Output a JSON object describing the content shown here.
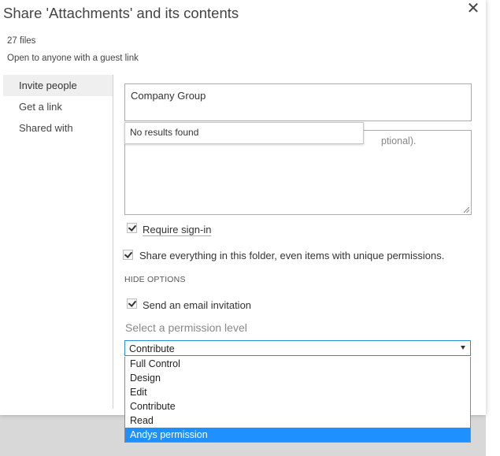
{
  "dialog": {
    "title": "Share 'Attachments' and its contents",
    "close_glyph": "✕",
    "file_count": "27 files",
    "sharing_status": "Open to anyone with a guest link"
  },
  "nav": {
    "items": [
      {
        "label": "Invite people",
        "active": true
      },
      {
        "label": "Get a link",
        "active": false
      },
      {
        "label": "Shared with",
        "active": false
      }
    ]
  },
  "invite": {
    "people_value": "Company Group",
    "people_suggestion": "No results found",
    "message_placeholder_visible_tail": "ptional)."
  },
  "options": {
    "require_signin": {
      "label": "Require sign-in",
      "checked": true
    },
    "share_everything": {
      "label": "Share everything in this folder, even items with unique permissions.",
      "checked": true
    },
    "hide_options_label": "HIDE OPTIONS",
    "send_email": {
      "label": "Send an email invitation",
      "checked": true
    }
  },
  "permission": {
    "label": "Select a permission level",
    "selected": "Contribute",
    "options": [
      "Full Control",
      "Design",
      "Edit",
      "Contribute",
      "Read",
      "Andys permission"
    ],
    "highlighted": "Andys permission"
  },
  "colors": {
    "accent": "#2a8dd4",
    "highlight": "#1e90ff",
    "nav_active_bg": "#efefef"
  },
  "icons": {
    "close": "close-icon",
    "checkbox": "checkmark-icon",
    "dropdown": "chevron-down-icon"
  }
}
